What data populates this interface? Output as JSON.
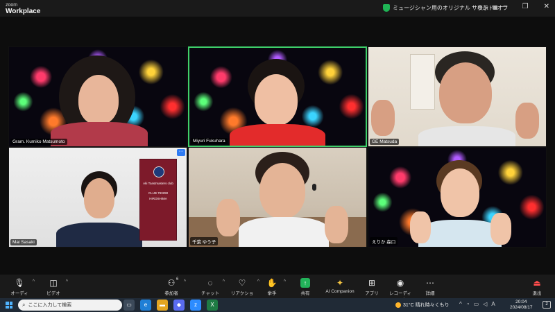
{
  "app": {
    "brand_top": "zoom",
    "brand_bottom": "Workplace"
  },
  "header": {
    "music_mode": "ミュージシャン用のオリジナル サウンド: オフ",
    "view_label": "表示",
    "window_controls": [
      "minimize-icon",
      "restore-icon",
      "close-icon"
    ]
  },
  "participants": [
    {
      "name": "Gram. Kumiko Matsumoto",
      "background": "fireworks"
    },
    {
      "name": "Miyuri Fukuhara",
      "background": "fireworks",
      "speaking": true
    },
    {
      "name": "GE Matsuda",
      "background": "room"
    },
    {
      "name": "Mai Sasaki",
      "background": "office",
      "banner": {
        "title": "Aki Toastmasters club",
        "club": "CLUB 793290",
        "line": "HIROSHIMA"
      }
    },
    {
      "name": "千葉 ゆう子",
      "background": "room"
    },
    {
      "name": "えりか 森口",
      "background": "fireworks"
    }
  ],
  "toolbar": {
    "audio": "オーディオ",
    "video": "ビデオ",
    "participants": "参加者",
    "participants_count": "6",
    "chat": "チャット",
    "reactions": "リアクション",
    "raise_hand": "挙手",
    "share": "共有",
    "ai_companion": "AI Companion",
    "apps": "アプリ",
    "record": "レコーディング",
    "more": "詳細",
    "leave": "退出"
  },
  "taskbar": {
    "search_placeholder": "ここに入力して検索",
    "weather": "31°C 晴れ時々くもり",
    "time": "20:04",
    "date": "2024/08/17",
    "ime": "A",
    "notifications": "2"
  },
  "colors": {
    "active_speaker": "#3fcf6a",
    "share": "#22b35a",
    "leave": "#ff4c4c",
    "accent": "#2e7bf3"
  }
}
